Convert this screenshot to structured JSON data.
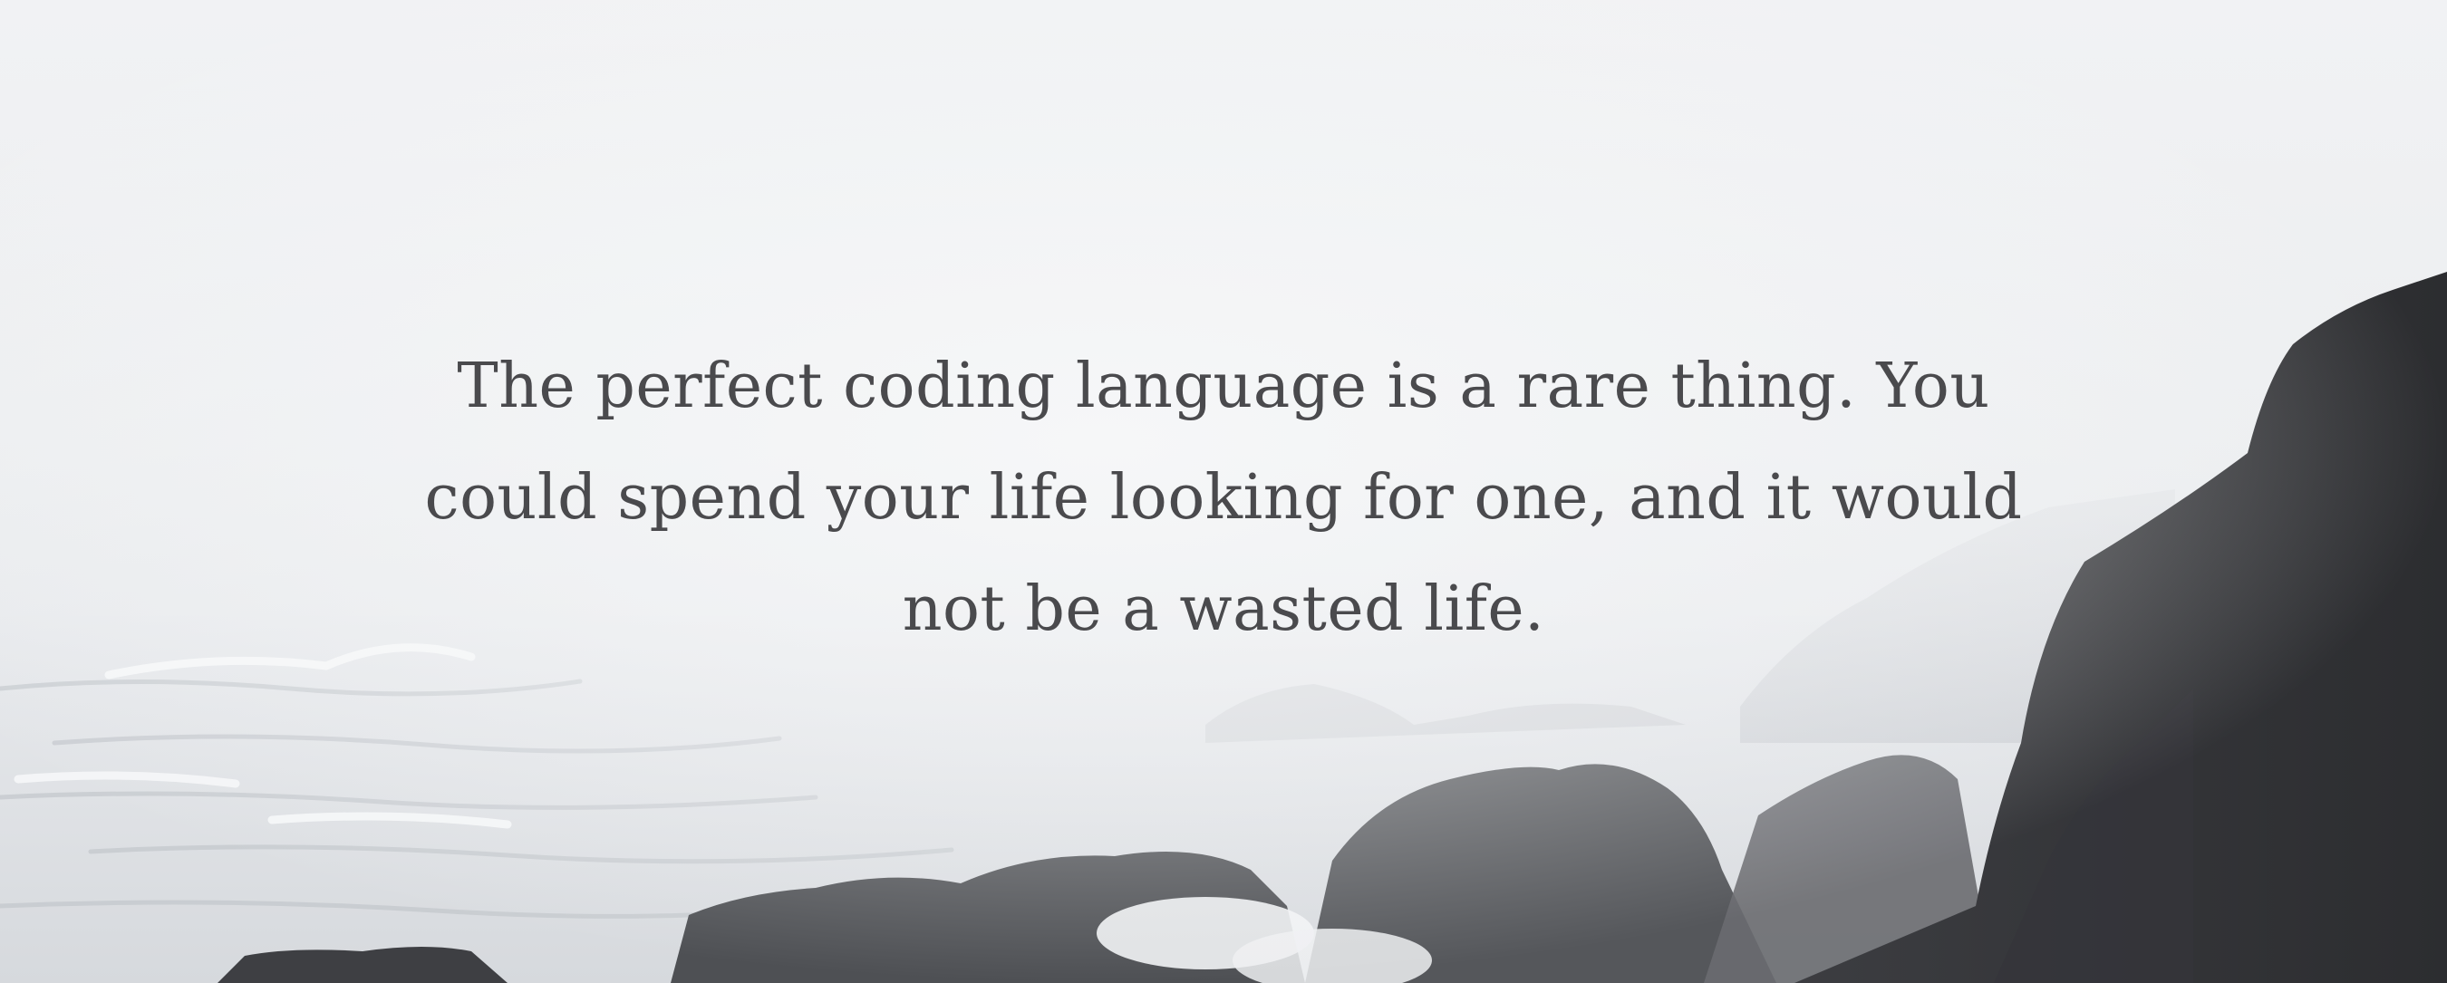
{
  "quote": {
    "text": "The perfect coding language is a rare thing. You could spend your life looking for one, and it would not be a wasted life."
  },
  "background": {
    "description_icon": "sea-cliff-photo",
    "tint": "#eeeff1",
    "text_color": "#4a4a4d"
  }
}
